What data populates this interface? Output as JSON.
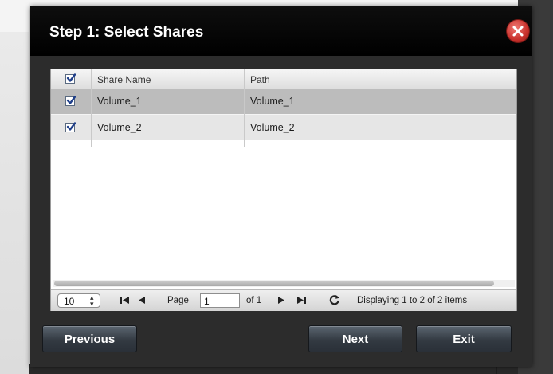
{
  "dialog": {
    "title": "Step 1: Select Shares"
  },
  "grid": {
    "columns": [
      "Share Name",
      "Path"
    ],
    "header_checkbox_checked": true,
    "rows": [
      {
        "checked": true,
        "share_name": "Volume_1",
        "path": "Volume_1"
      },
      {
        "checked": true,
        "share_name": "Volume_2",
        "path": "Volume_2"
      }
    ]
  },
  "pager": {
    "page_size": "10",
    "page_label": "Page",
    "page_value": "1",
    "of_label": "of 1",
    "display_text": "Displaying 1 to 2 of 2 items"
  },
  "footer": {
    "previous_label": "Previous",
    "next_label": "Next",
    "exit_label": "Exit"
  },
  "icons": {
    "close": "close-icon",
    "first": "first-page-icon",
    "prev": "previous-page-icon",
    "next": "next-page-icon",
    "last": "last-page-icon",
    "refresh": "refresh-icon"
  },
  "colors": {
    "title_bar": "#000000",
    "dialog_body": "#2c2c2c",
    "close_red": "#c8302b",
    "selected_row": "#bcbcbc",
    "check_blue": "#1f3f8a"
  }
}
